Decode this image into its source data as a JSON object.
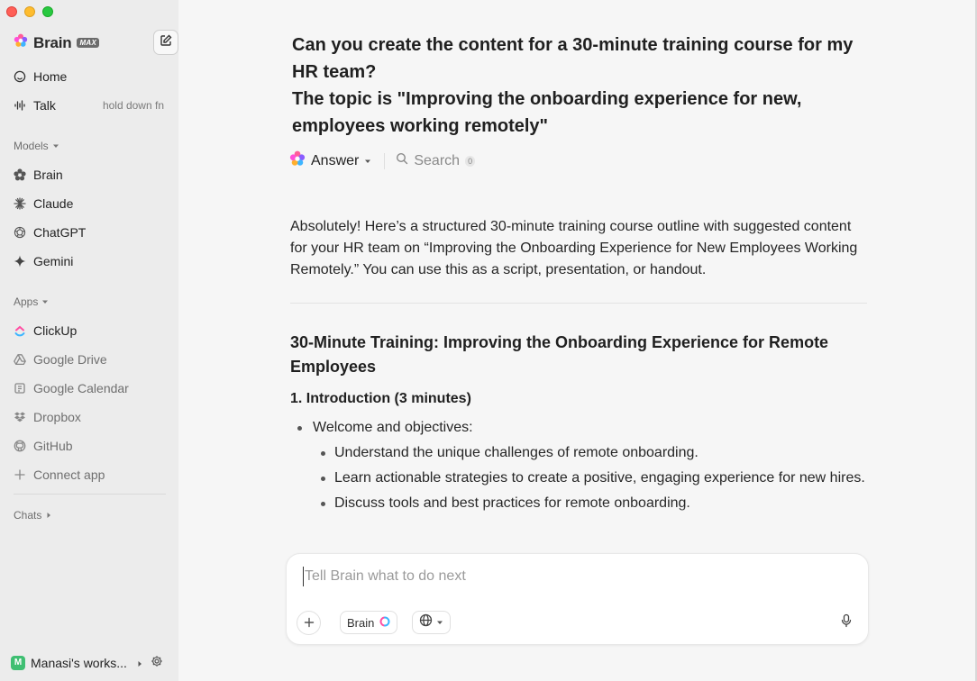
{
  "brand": {
    "name": "Brain",
    "badge": "MAX"
  },
  "sidebar": {
    "nav": [
      {
        "label": "Home",
        "icon": "home-icon"
      },
      {
        "label": "Talk",
        "icon": "waveform-icon",
        "hint": "hold down fn"
      }
    ],
    "models_label": "Models",
    "models": [
      {
        "label": "Brain",
        "icon": "brain-icon"
      },
      {
        "label": "Claude",
        "icon": "claude-icon"
      },
      {
        "label": "ChatGPT",
        "icon": "chatgpt-icon"
      },
      {
        "label": "Gemini",
        "icon": "gemini-icon"
      }
    ],
    "apps_label": "Apps",
    "apps": [
      {
        "label": "ClickUp",
        "icon": "clickup-icon"
      },
      {
        "label": "Google Drive",
        "icon": "google-drive-icon"
      },
      {
        "label": "Google Calendar",
        "icon": "google-calendar-icon"
      },
      {
        "label": "Dropbox",
        "icon": "dropbox-icon"
      },
      {
        "label": "GitHub",
        "icon": "github-icon"
      },
      {
        "label": "Connect app",
        "icon": "plus-icon"
      }
    ],
    "chats_label": "Chats",
    "workspace": {
      "initial": "M",
      "name": "Manasi's works..."
    }
  },
  "chat": {
    "question_line1": "Can you create the content for a 30-minute training course for my HR team?",
    "question_line2": "The topic is \"Improving the onboarding experience for new, employees working remotely\"",
    "tabs": {
      "answer": "Answer",
      "search": "Search",
      "search_count": "0"
    },
    "answer": {
      "intro": "Absolutely! Here’s a structured 30-minute training course outline with suggested content for your HR team on “Improving the Onboarding Experience for New Employees Working Remotely.” You can use this as a script, presentation, or handout.",
      "heading": "30-Minute Training: Improving the Onboarding Experience for Remote Employees",
      "section1_title": "1. Introduction (3 minutes)",
      "bullet1": "Welcome and objectives:",
      "sub_bullets": [
        "Understand the unique challenges of remote onboarding.",
        "Learn actionable strategies to create a positive, engaging experience for new hires.",
        "Discuss tools and best practices for remote onboarding."
      ]
    }
  },
  "composer": {
    "placeholder": "Tell Brain what to do next",
    "model_label": "Brain"
  },
  "colors": {
    "sidebar_bg": "#ececec",
    "main_bg": "#f6f6f6",
    "workspace_avatar": "#3fbf72"
  }
}
